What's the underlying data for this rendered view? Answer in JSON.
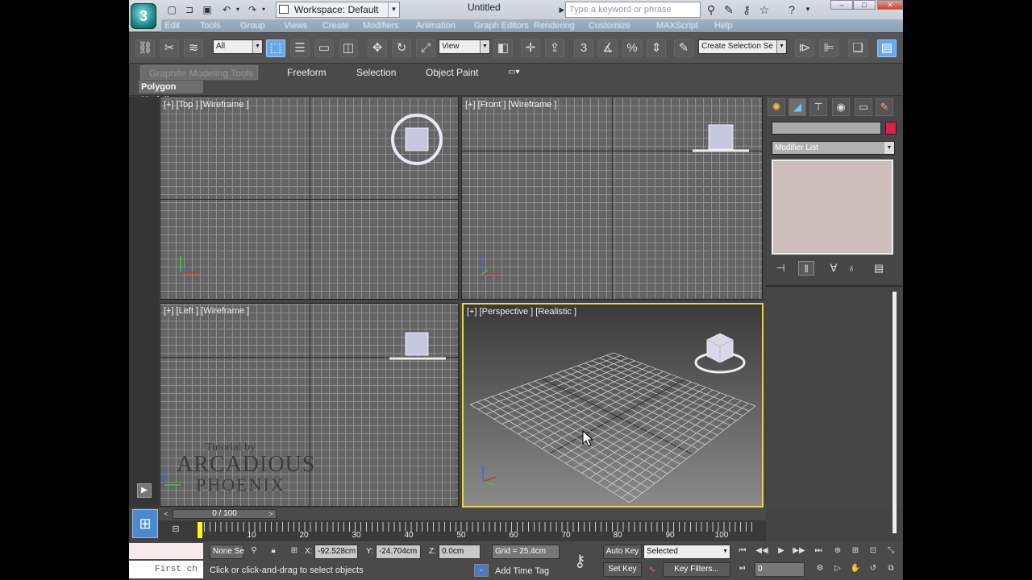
{
  "app": {
    "logo": "3",
    "workspace": "Workspace: Default",
    "document_title": "Untitled",
    "search_placeholder": "Type a keyword or phrase",
    "menus": [
      "Edit",
      "Tools",
      "Group",
      "Views",
      "Create",
      "Modifiers",
      "Animation",
      "Graph Editors",
      "Rendering",
      "Customize",
      "MAXScript",
      "Help"
    ]
  },
  "toolbar": {
    "selection_filter": "All",
    "ref_coord": "View",
    "named_selection": "Create Selection Se",
    "snap_number": "3"
  },
  "ribbon": {
    "tabs": [
      "Graphite Modeling Tools",
      "Freeform",
      "Selection",
      "Object Paint"
    ],
    "panel": "Polygon Modeling"
  },
  "viewports": {
    "top": "[+] [Top ] [Wireframe ]",
    "front": "[+] [Front ] [Wireframe ]",
    "left": "[+] [Left ] [Wireframe ]",
    "perspective": "[+] [Perspective ] [Realistic ]"
  },
  "watermark": {
    "line1": "Tutorial by",
    "line2": "ARCADIOUS",
    "line3": "PHOENIX"
  },
  "command_panel": {
    "modifier_list": "Modifier List",
    "color": "#e0204a"
  },
  "timeline": {
    "slider": "0 / 100",
    "ticks": [
      "10",
      "20",
      "30",
      "40",
      "50",
      "60",
      "70",
      "80",
      "90",
      "100"
    ]
  },
  "status": {
    "selection": "None Se",
    "x_label": "X:",
    "x_value": "-92.528cm",
    "y_label": "Y:",
    "y_value": "-24.704cm",
    "z_label": "Z:",
    "z_value": "0.0cm",
    "grid": "Grid = 25.4cm",
    "prompt": "Click or click-and-drag to select objects",
    "add_time_tag": "Add Time Tag",
    "auto_key": "Auto Key",
    "set_key": "Set Key",
    "selected": "Selected",
    "key_filters": "Key Filters...",
    "frame": "0",
    "maxscript": "First ch"
  }
}
